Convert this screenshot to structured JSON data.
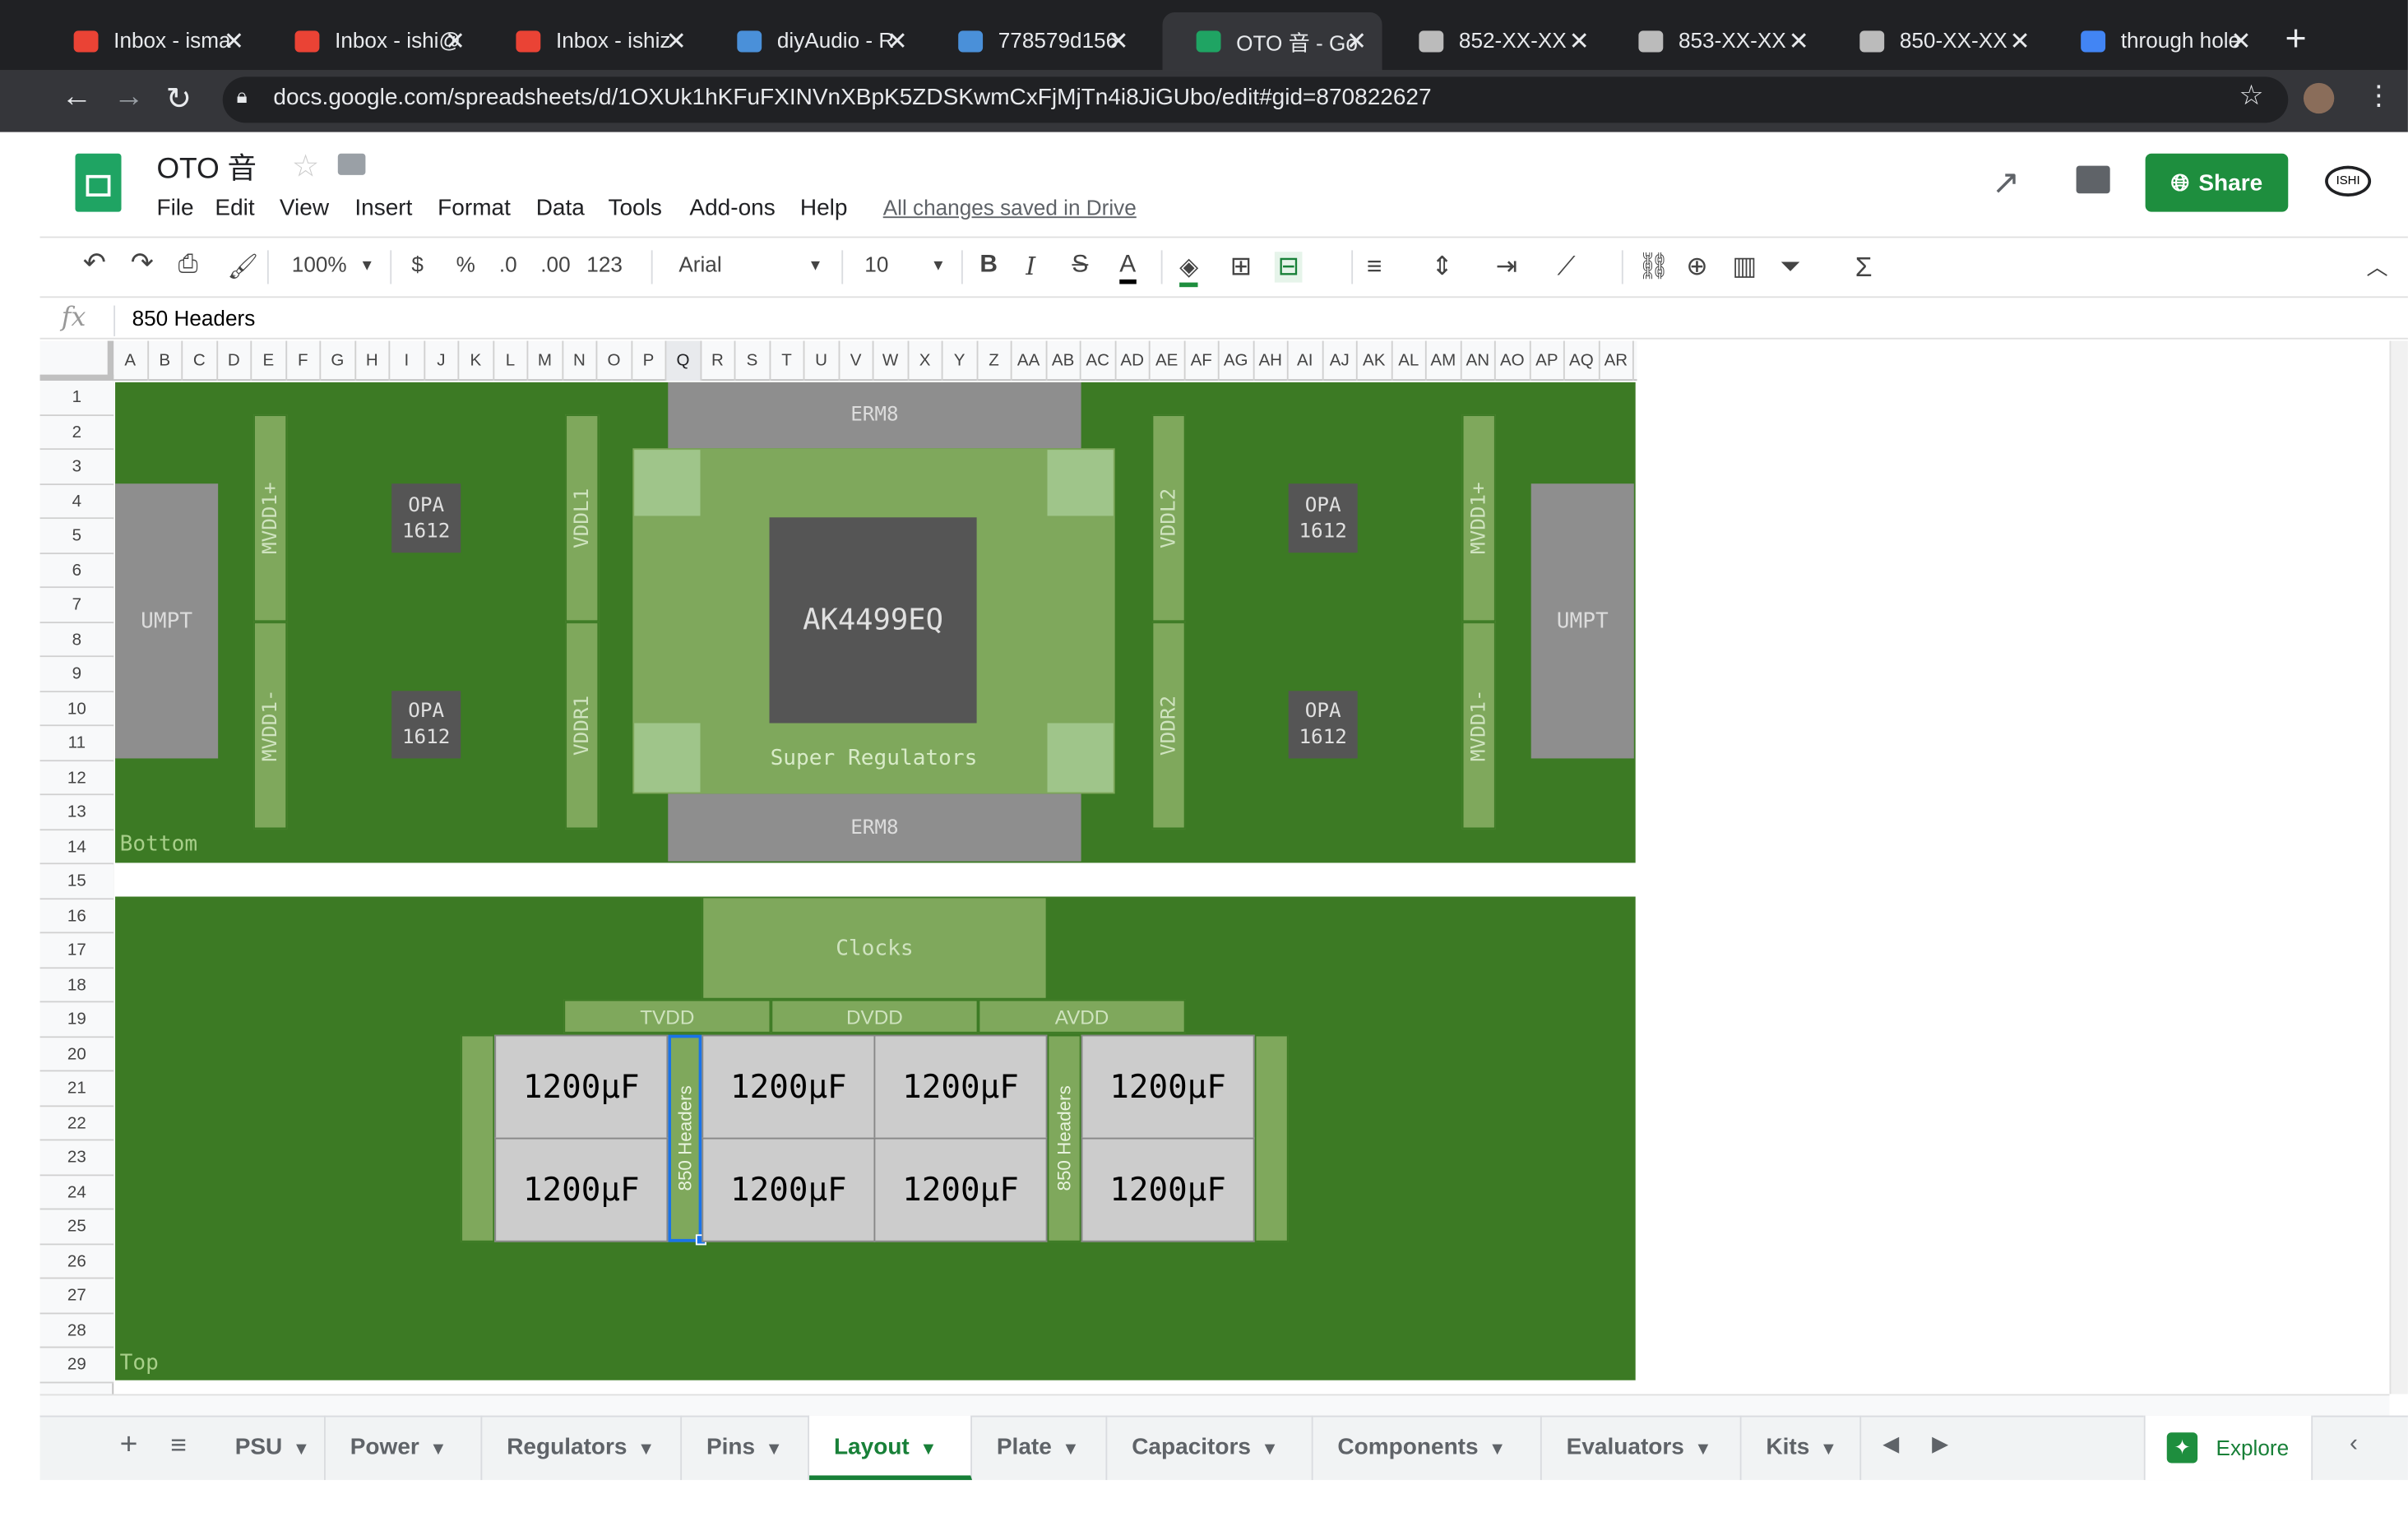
{
  "browser": {
    "tabs": [
      {
        "title": "Inbox - isma",
        "icon": "gmail-icon"
      },
      {
        "title": "Inbox - ishi@",
        "icon": "gmail-icon"
      },
      {
        "title": "Inbox - ishiz",
        "icon": "gmail-icon"
      },
      {
        "title": "diyAudio - R",
        "icon": "diyaudio-icon"
      },
      {
        "title": "778579d156",
        "icon": "diyaudio-icon"
      },
      {
        "title": "OTO 音 - Go",
        "icon": "sheets-icon",
        "active": true
      },
      {
        "title": "852-XX-XX",
        "icon": "mill-max-icon"
      },
      {
        "title": "853-XX-XX",
        "icon": "mill-max-icon"
      },
      {
        "title": "850-XX-XX",
        "icon": "mill-max-icon"
      },
      {
        "title": "through hole",
        "icon": "google-icon"
      }
    ],
    "url": "docs.google.com/spreadsheets/d/1OXUk1hKFuFXINVnXBpK5ZDSKwmCxFjMjTn4i8JiGUbo/edit#gid=870822627"
  },
  "doc": {
    "title": "OTO 音",
    "saved": "All changes saved in Drive",
    "share": "Share",
    "menu": [
      "File",
      "Edit",
      "View",
      "Insert",
      "Format",
      "Data",
      "Tools",
      "Add-ons",
      "Help"
    ]
  },
  "toolbar": {
    "zoom": "100%",
    "currency": "$",
    "percent": "%",
    "dec_less": ".0",
    "dec_more": ".00",
    "format": "123",
    "font": "Arial",
    "size": "10"
  },
  "formula": {
    "fx": "fx",
    "value": "850 Headers"
  },
  "columns": [
    "A",
    "B",
    "C",
    "D",
    "E",
    "F",
    "G",
    "H",
    "I",
    "J",
    "K",
    "L",
    "M",
    "N",
    "O",
    "P",
    "Q",
    "R",
    "S",
    "T",
    "U",
    "V",
    "W",
    "X",
    "Y",
    "Z",
    "AA",
    "AB",
    "AC",
    "AD",
    "AE",
    "AF",
    "AG",
    "AH",
    "AI",
    "AJ",
    "AK",
    "AL",
    "AM",
    "AN",
    "AO",
    "AP",
    "AQ",
    "AR"
  ],
  "rows": [
    "1",
    "2",
    "3",
    "4",
    "5",
    "6",
    "7",
    "8",
    "9",
    "10",
    "11",
    "12",
    "13",
    "14",
    "15",
    "16",
    "17",
    "18",
    "19",
    "20",
    "21",
    "22",
    "23",
    "24",
    "25",
    "26",
    "27",
    "28",
    "29"
  ],
  "layout": {
    "bottom_label": "Bottom",
    "top_label": "Top",
    "erm8_top": "ERM8",
    "erm8_bot": "ERM8",
    "chip": "AK4499EQ",
    "super_reg": "Super Regulators",
    "umpt_l": "UMPT",
    "umpt_r": "UMPT",
    "opa_tl": "OPA\n1612",
    "opa_bl": "OPA\n1612",
    "opa_tr": "OPA\n1612",
    "opa_br": "OPA\n1612",
    "mvdd1p_l": "MVDD1+",
    "mvdd1m_l": "MVDD1-",
    "vddl1": "VDDL1",
    "vddr1": "VDDR1",
    "vddl2": "VDDL2",
    "vddr2": "VDDR2",
    "mvdd1p_r": "MVDD1+",
    "mvdd1m_r": "MVDD1-",
    "clocks": "Clocks",
    "tvdd": "TVDD",
    "dvdd": "DVDD",
    "avdd": "AVDD",
    "header1": "850 Headers",
    "header2": "850 Headers",
    "caps": [
      "1200µF",
      "1200µF",
      "1200µF",
      "1200µF",
      "1200µF",
      "1200µF",
      "1200µF",
      "1200µF"
    ]
  },
  "sheets": [
    "PSU",
    "Power",
    "Regulators",
    "Pins",
    "Layout",
    "Plate",
    "Capacitors",
    "Components",
    "Evaluators",
    "Kits"
  ],
  "explore": "Explore"
}
